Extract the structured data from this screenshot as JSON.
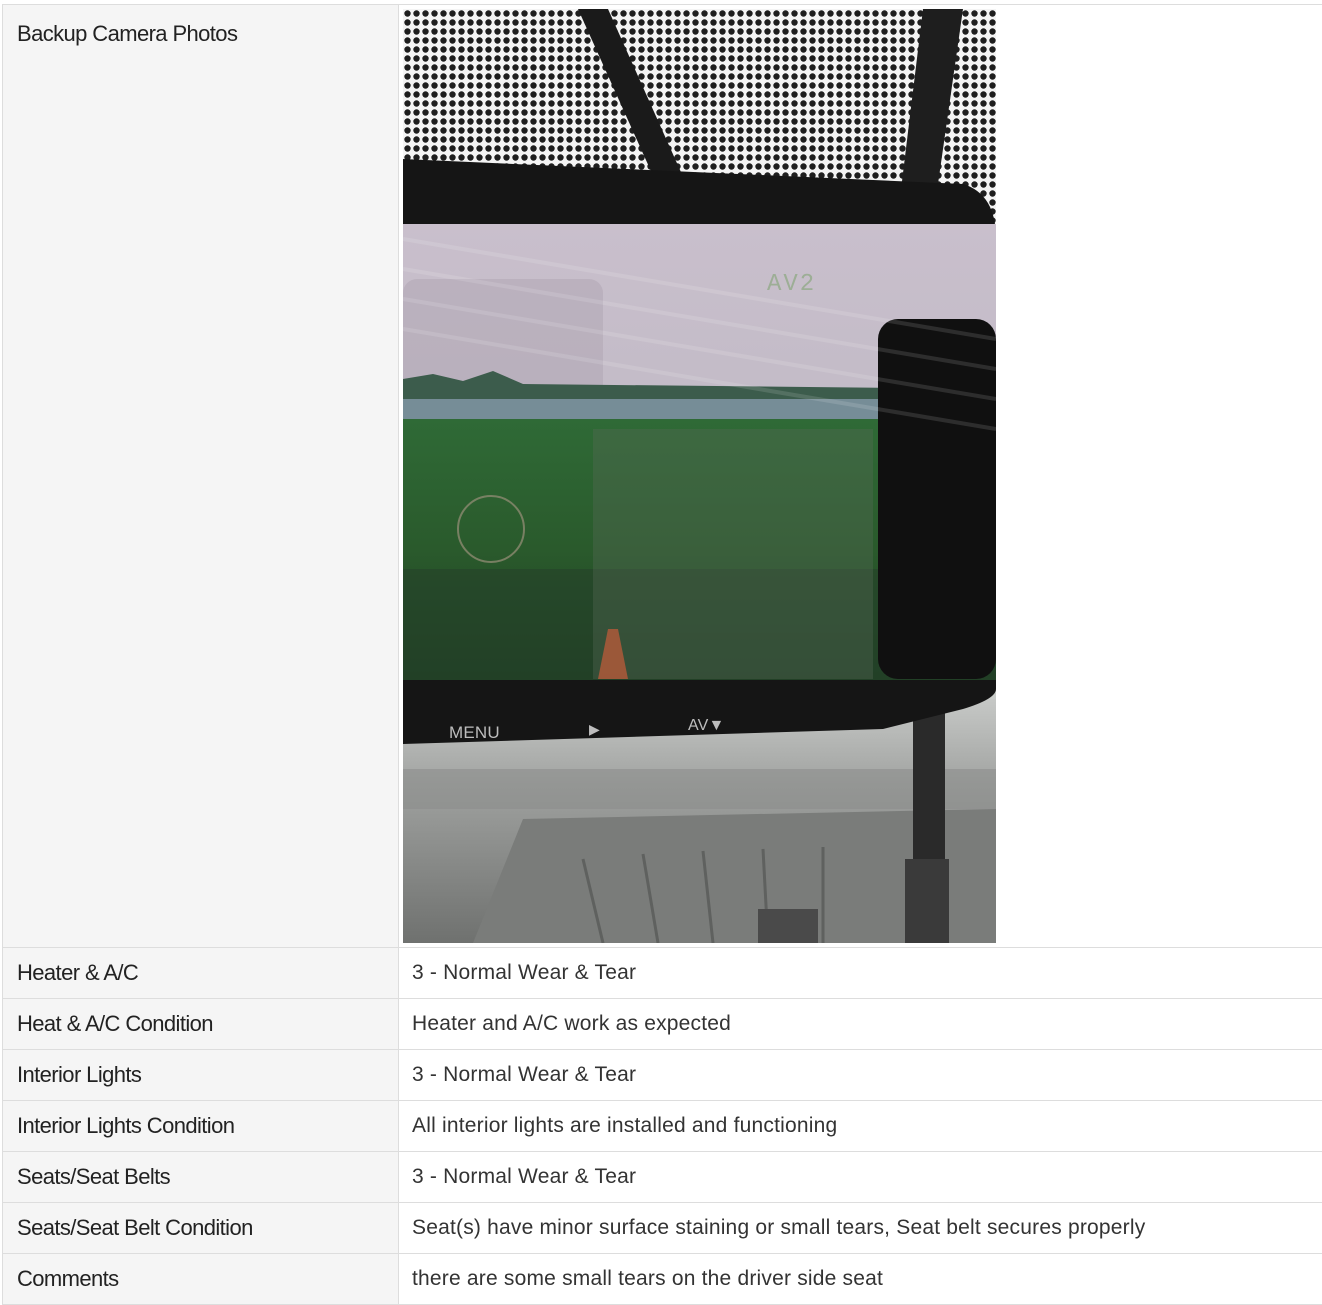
{
  "rows": [
    {
      "label": "Backup Camera Photos",
      "photo": {
        "osd": "AV2",
        "menu": "MENU",
        "play": "▶",
        "av": "AV▼"
      }
    },
    {
      "label": "Heater & A/C",
      "value": "3 - Normal Wear & Tear"
    },
    {
      "label": "Heat & A/C Condition",
      "value": "Heater and A/C work as expected"
    },
    {
      "label": "Interior Lights",
      "value": "3 - Normal Wear & Tear"
    },
    {
      "label": "Interior Lights Condition",
      "value": "All interior lights are installed and functioning"
    },
    {
      "label": "Seats/Seat Belts",
      "value": "3 - Normal Wear & Tear"
    },
    {
      "label": "Seats/Seat Belt Condition",
      "value": "Seat(s) have minor surface staining or small tears, Seat belt secures properly"
    },
    {
      "label": "Comments",
      "value": "there are some small tears on the driver side seat"
    }
  ]
}
